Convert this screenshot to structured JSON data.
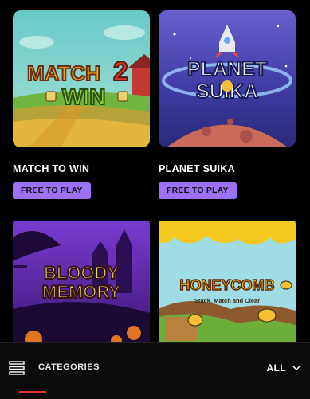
{
  "games": [
    {
      "title": "MATCH TO WIN",
      "cta": "FREE TO PLAY",
      "logo_line1": "MATCH",
      "logo_num": "2",
      "logo_line2": "WIN"
    },
    {
      "title": "PLANET SUIKA",
      "cta": "FREE TO PLAY",
      "logo_line1": "PLANET",
      "logo_line2": "SUIKA"
    },
    {
      "title": "",
      "cta": "",
      "logo_line1": "BLOODY",
      "logo_line2": "MEMORY"
    },
    {
      "title": "",
      "cta": "",
      "logo_line1": "HONEYCOMB",
      "logo_line2": "Stack, Match and Clear"
    }
  ],
  "bottom_bar": {
    "categories_label": "CATEGORIES",
    "filter_value": "ALL",
    "icons": {
      "categories": "categories-list-icon",
      "filter": "chevron-down-icon"
    }
  },
  "colors": {
    "badge": "#9b72f5",
    "accent": "#e6352b",
    "background": "#000000"
  }
}
